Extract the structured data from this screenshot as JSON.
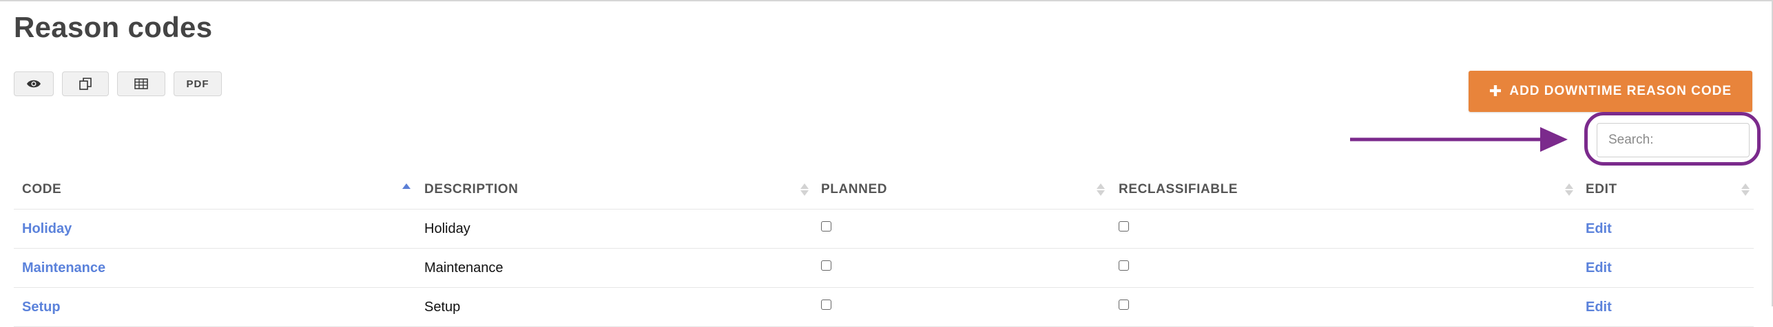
{
  "page": {
    "title": "Reason codes"
  },
  "toolbar": {
    "buttons": [
      {
        "name": "view-icon",
        "label": ""
      },
      {
        "name": "copy-icon",
        "label": ""
      },
      {
        "name": "table-icon",
        "label": ""
      },
      {
        "name": "pdf-button",
        "label": "PDF"
      }
    ]
  },
  "actions": {
    "add_label": "ADD DOWNTIME REASON CODE",
    "add_icon": "plus-icon"
  },
  "search": {
    "placeholder": "Search:",
    "value": ""
  },
  "annotation": {
    "color": "#7b2a8c"
  },
  "colors": {
    "accent": "#e8843b",
    "link": "#5b82db",
    "sort_active": "#5b7fd6"
  },
  "table": {
    "columns": [
      "CODE",
      "DESCRIPTION",
      "PLANNED",
      "RECLASSIFIABLE",
      "EDIT"
    ],
    "sorted_column": "CODE",
    "sort_direction": "ascending",
    "rows": [
      {
        "code": "Holiday",
        "description": "Holiday",
        "planned": false,
        "reclassifiable": false,
        "edit": "Edit"
      },
      {
        "code": "Maintenance",
        "description": "Maintenance",
        "planned": false,
        "reclassifiable": false,
        "edit": "Edit"
      },
      {
        "code": "Setup",
        "description": "Setup",
        "planned": false,
        "reclassifiable": false,
        "edit": "Edit"
      }
    ]
  }
}
